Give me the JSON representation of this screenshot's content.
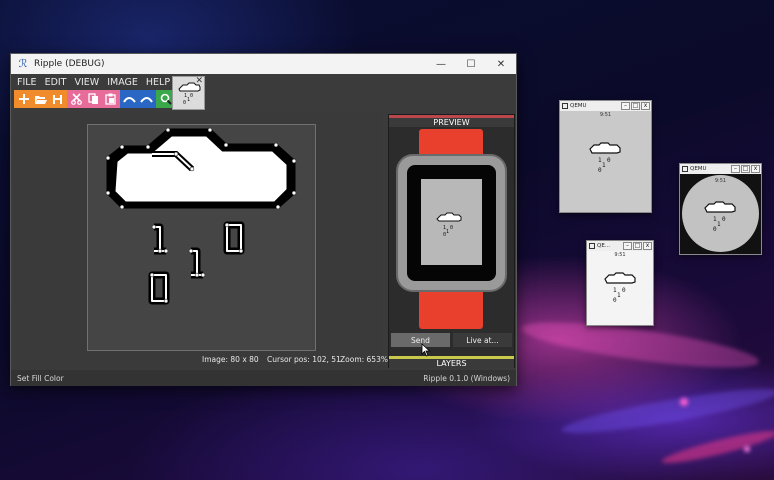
{
  "main_window": {
    "title": "Ripple (DEBUG)",
    "controls": {
      "minimize": "—",
      "maximize": "☐",
      "close": "✕"
    }
  },
  "menu": [
    "FILE",
    "EDIT",
    "VIEW",
    "IMAGE",
    "HELP"
  ],
  "toolbar_icons": [
    "new-icon",
    "open-icon",
    "save-icon",
    "cut-icon",
    "copy-icon",
    "paste-icon",
    "undo-icon",
    "redo-icon",
    "fill-icon"
  ],
  "tab": {
    "close": "✕"
  },
  "status": {
    "image": "Image: 80 x 80",
    "cursor": "Cursor pos: 102, 51",
    "zoom": "Zoom: 653%"
  },
  "preview": {
    "header": "PREVIEW",
    "send": "Send",
    "live": "Live at...",
    "layers": "LAYERS"
  },
  "statusbar": {
    "left": "Set Fill Color",
    "right": "Ripple 0.1.0 (Windows)"
  },
  "qemu_windows": [
    {
      "title": "QEMU",
      "time": "9:51"
    },
    {
      "title": "QEMU",
      "time": "9:51"
    },
    {
      "title": "QE...",
      "time": "9:51"
    }
  ],
  "colors": {
    "orange": "#f08c2c",
    "pink": "#e86c9a",
    "blue": "#2a67c4",
    "green": "#3aa84a",
    "preview_accent": "#b9474c",
    "layers_accent": "#c8c84a",
    "watch_band": "#e8402c"
  }
}
